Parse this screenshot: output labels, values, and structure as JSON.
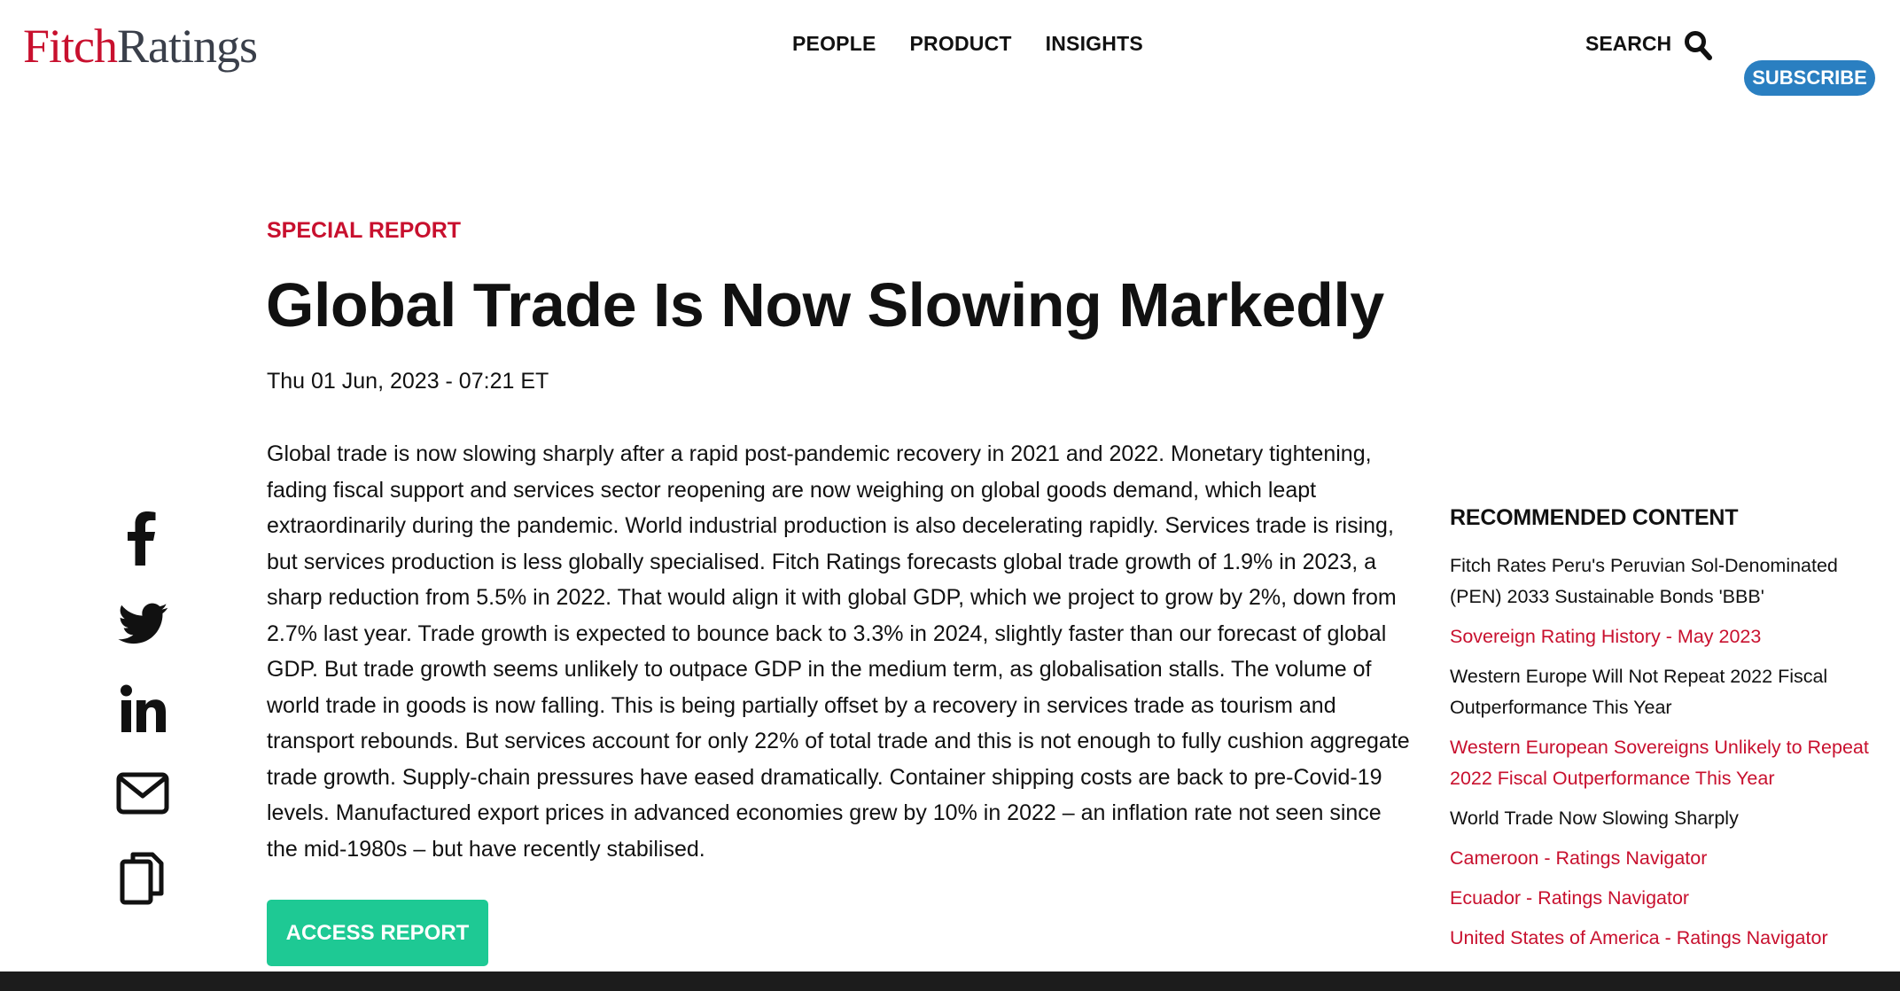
{
  "header": {
    "logo_part1": "Fitch",
    "logo_part2": "Ratings",
    "nav": [
      "PEOPLE",
      "PRODUCT",
      "INSIGHTS"
    ],
    "search_label": "SEARCH",
    "subscribe_label": "SUBSCRIBE"
  },
  "article": {
    "kicker": "SPECIAL REPORT",
    "title": "Global Trade Is Now Slowing Markedly",
    "dateline": "Thu 01 Jun, 2023 - 07:21 ET",
    "body": "Global trade is now slowing sharply after a rapid post-pandemic recovery in 2021 and 2022. Monetary tightening, fading fiscal support and services sector reopening are now weighing on global goods demand, which leapt extraordinarily during the pandemic. World industrial production is also decelerating rapidly. Services trade is rising, but services production is less globally specialised. Fitch Ratings forecasts global trade growth of 1.9% in 2023, a sharp reduction from 5.5% in 2022. That would align it with global GDP, which we project to grow by 2%, down from 2.7% last year. Trade growth is expected to bounce back to 3.3% in 2024, slightly faster than our forecast of global GDP. But trade growth seems unlikely to outpace GDP in the medium term, as globalisation stalls. The volume of world trade in goods is now falling. This is being partially offset by a recovery in services trade as tourism and transport rebounds. But services account for only 22% of total trade and this is not enough to fully cushion aggregate trade growth. Supply-chain pressures have eased dramatically. Container shipping costs are back to pre-Covid-19 levels. Manufactured export prices in advanced economies grew by 10% in 2022 – an inflation rate not seen since the mid-1980s – but have recently stabilised.",
    "cta_label": "ACCESS REPORT"
  },
  "share": [
    "facebook-icon",
    "twitter-icon",
    "linkedin-icon",
    "email-icon",
    "copy-icon"
  ],
  "sidebar": {
    "heading": "RECOMMENDED CONTENT",
    "items": [
      {
        "label": "Fitch Rates Peru's Peruvian Sol-Denominated (PEN) 2033 Sustainable Bonds 'BBB'",
        "color": "#111111"
      },
      {
        "label": "Sovereign Rating History - May 2023",
        "color": "#c8102e"
      },
      {
        "label": "Western Europe Will Not Repeat 2022 Fiscal Outperformance This Year",
        "color": "#111111"
      },
      {
        "label": "Western European Sovereigns Unlikely to Repeat 2022 Fiscal Outperformance This Year",
        "color": "#c8102e"
      },
      {
        "label": "World Trade Now Slowing Sharply",
        "color": "#111111"
      },
      {
        "label": "Cameroon - Ratings Navigator",
        "color": "#c8102e"
      },
      {
        "label": "Ecuador - Ratings Navigator",
        "color": "#c8102e"
      },
      {
        "label": "United States of America - Ratings Navigator",
        "color": "#c8102e"
      }
    ]
  },
  "colors": {
    "brand_red": "#c8102e",
    "subscribe_blue": "#2a7fc1",
    "cta_green": "#1ec994"
  }
}
